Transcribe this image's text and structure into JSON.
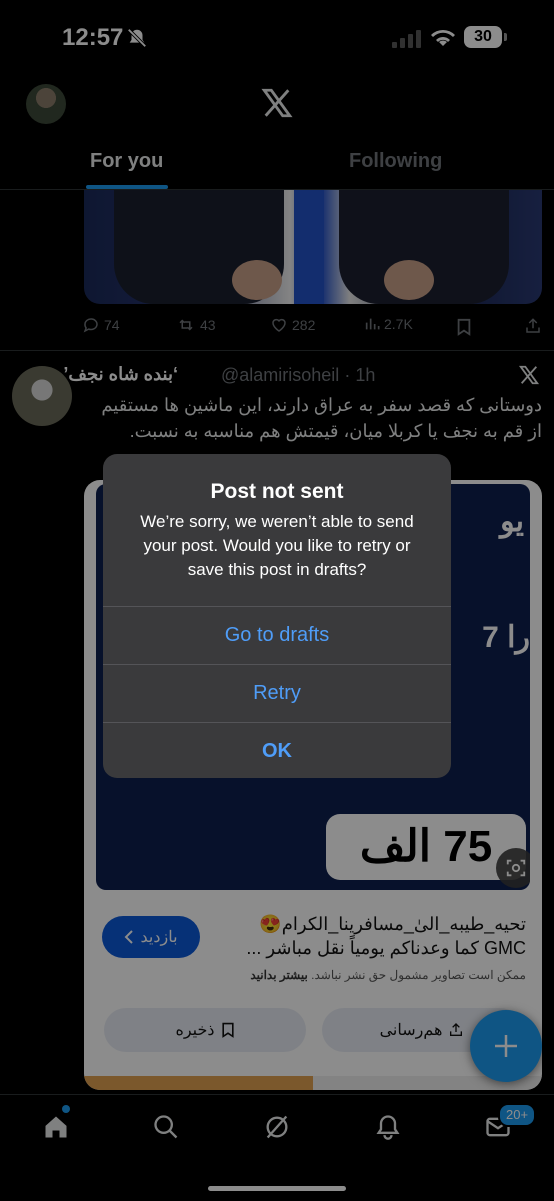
{
  "status_bar": {
    "time": "12:57",
    "battery": "30"
  },
  "header": {
    "tabs": [
      "For you",
      "Following"
    ],
    "active_tab": "For you"
  },
  "tweet1": {
    "replies": "74",
    "reposts": "43",
    "likes": "282",
    "views": "2.7K"
  },
  "tweet2": {
    "name": "‘بنده شاه نجف’",
    "handle": "@alamirisoheil",
    "time": "· 1h",
    "text": "دوستانی که قصد سفر به عراق دارند، این ماشین ها مستقیم از قم به نجف یا کربلا میان، قیمتش هم مناسبه به نسبت.",
    "card": {
      "img_text_1": "یو",
      "img_text_2": "7 را",
      "price": "75 الف",
      "visit_label": "بازدید",
      "text_line1": "تحیه_طیبه_الیٰ_مسافرینا_الکرام😍",
      "text_line2": "GMC كما وعدناكم يومياً نقل مباشر ...",
      "note": "ممکن است تصاویر مشمول حق نشر نباشد.",
      "note_more": "بیشتر بدانید",
      "save_label": "ذخیره",
      "share_label": "هم‌رسانی"
    }
  },
  "alert": {
    "title": "Post not sent",
    "message": "We’re sorry, we weren’t able to send your post. Would you like to retry or save this post in drafts?",
    "buttons": {
      "drafts": "Go to drafts",
      "retry": "Retry",
      "ok": "OK"
    }
  },
  "bottom_nav": {
    "messages_badge": "20+"
  },
  "colors": {
    "accent": "#1d9bf0",
    "alert_button": "#4f9df8",
    "alert_bg": "#3a3a3c"
  }
}
